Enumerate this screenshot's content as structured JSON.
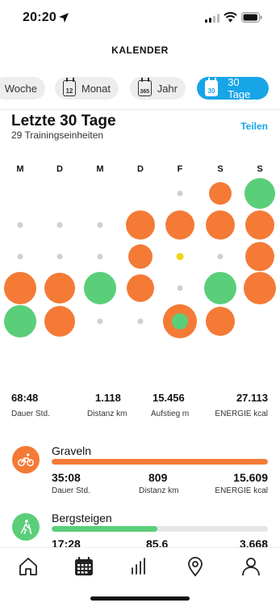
{
  "status_bar": {
    "time": "20:20"
  },
  "header": {
    "title": "KALENDER"
  },
  "tabs": [
    {
      "label": "Woche",
      "icon": ""
    },
    {
      "label": "Monat",
      "icon": "12"
    },
    {
      "label": "Jahr",
      "icon": "365"
    },
    {
      "label": "30 Tage",
      "icon": "30",
      "active": true
    }
  ],
  "period": {
    "title": "Letzte 30 Tage",
    "subtitle": "29 Trainingseinheiten",
    "share_label": "Teilen"
  },
  "calendar": {
    "weekdays": [
      "M",
      "D",
      "M",
      "D",
      "F",
      "S",
      "S"
    ],
    "colors": {
      "orange": "#f47a36",
      "green": "#5ace79",
      "today": "#f2d31a",
      "empty": "#cfcfcf"
    }
  },
  "summary": [
    {
      "value": "68:48",
      "label": "Dauer Std."
    },
    {
      "value": "1.118",
      "label": "Distanz km"
    },
    {
      "value": "15.456",
      "label": "Aufstieg m"
    },
    {
      "value": "27.113",
      "label": "ENERGIE kcal"
    }
  ],
  "activities": [
    {
      "name": "Graveln",
      "icon": "cycling-icon",
      "color": "#f47a36",
      "share": 1.0,
      "stats": [
        {
          "value": "35:08",
          "label": "Dauer Std."
        },
        {
          "value": "809",
          "label": "Distanz km"
        },
        {
          "value": "15.609",
          "label": "ENERGIE kcal"
        }
      ]
    },
    {
      "name": "Bergsteigen",
      "icon": "hiking-icon",
      "color": "#5ace79",
      "share": 0.49,
      "stats": [
        {
          "value": "17:28",
          "label": ""
        },
        {
          "value": "85.6",
          "label": ""
        },
        {
          "value": "3.668",
          "label": ""
        }
      ]
    }
  ],
  "nav": [
    "home-icon",
    "calendar-icon",
    "stats-icon",
    "map-pin-icon",
    "profile-icon"
  ]
}
